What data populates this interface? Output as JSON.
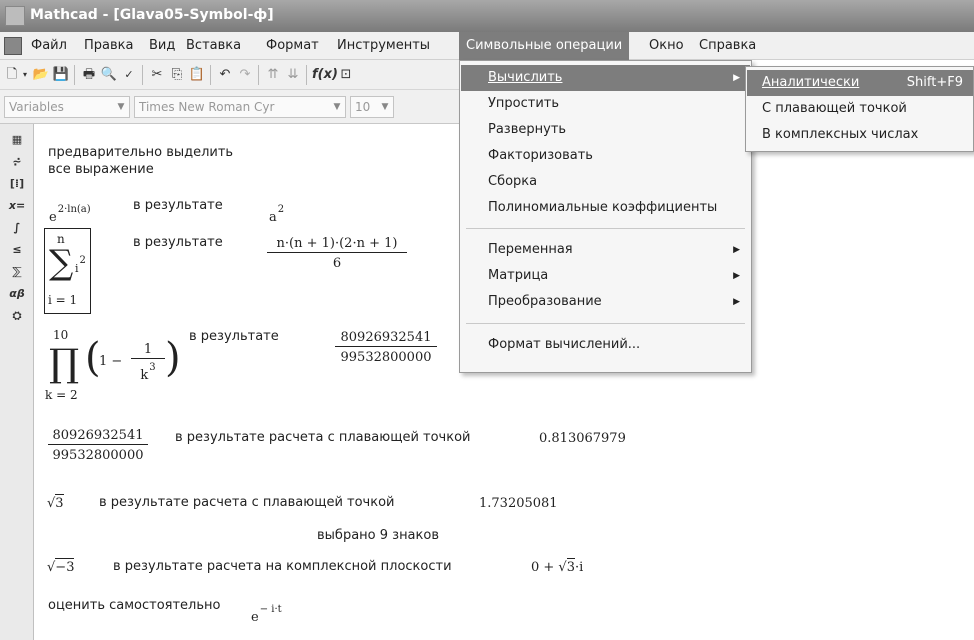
{
  "window": {
    "title": "Mathcad - [Glava05-Symbol-ф]"
  },
  "menubar": {
    "items": [
      "Файл",
      "Правка",
      "Вид",
      "Вставка",
      "Формат",
      "Инструменты",
      "Символьные операции",
      "Окно",
      "Справка"
    ]
  },
  "toolbar2": {
    "style_combo": "Variables",
    "font_combo": "Times New Roman Cyr",
    "size_combo": "10"
  },
  "dropdown": {
    "items": [
      {
        "label": "Вычислить",
        "has_submenu": true
      },
      {
        "label": "Упростить"
      },
      {
        "label": "Развернуть"
      },
      {
        "label": "Факторизовать"
      },
      {
        "label": "Сборка"
      },
      {
        "label": "Полиномиальные коэффициенты"
      },
      {
        "label": "Переменная",
        "has_submenu": true
      },
      {
        "label": "Матрица",
        "has_submenu": true
      },
      {
        "label": "Преобразование",
        "has_submenu": true
      },
      {
        "label": "Формат вычислений..."
      }
    ]
  },
  "submenu": {
    "items": [
      {
        "label": "Аналитически",
        "shortcut": "Shift+F9"
      },
      {
        "label": "С плавающей точкой"
      },
      {
        "label": "В комплексных числах"
      }
    ]
  },
  "worksheet": {
    "intro_line1": "предварительно выделить",
    "intro_line2": "все выражение",
    "result_label": "в результате",
    "expr1": "e",
    "expr1_exp": "2·ln(a)",
    "result1": "a",
    "result1_exp": "2",
    "sum_top": "n",
    "sum_bottom": "i = 1",
    "sum_term": "i",
    "sum_term_exp": "2",
    "result2_num": "n·(n + 1)·(2·n + 1)",
    "result2_den": "6",
    "prod_top": "10",
    "prod_bottom": "k = 2",
    "prod_term_pre": "1 −",
    "prod_inner_num": "1",
    "prod_inner_den": "k",
    "prod_inner_den_exp": "3",
    "result3_num": "80926932541",
    "result3_den": "99532800000",
    "frac4_num": "80926932541",
    "frac4_den": "99532800000",
    "float_label": "в результате расчета с плавающей точкой",
    "result4": "0.813067979",
    "sqrt3": "3",
    "result5": "1.73205081",
    "digits_note": "выбрано 9 знаков",
    "sqrtm3": "−3",
    "complex_label": "в результате расчета на комплексной плоскости",
    "result6_pre": "0 +",
    "result6_rad": "3",
    "result6_post": "·i",
    "self_label": "оценить самостоятельно",
    "expr7": "e",
    "expr7_exp": "− i·t"
  }
}
